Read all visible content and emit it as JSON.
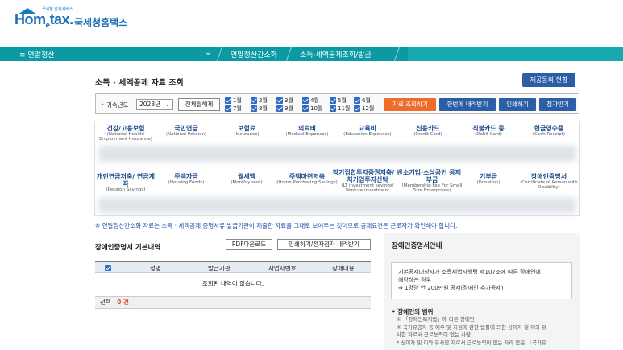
{
  "header": {
    "logo_home": "Hom",
    "logo_e": "e",
    "logo_tax": "tax.",
    "logo_tagline": "국세청 납세서비스",
    "logo_kr": "국세청홈택스"
  },
  "nav": {
    "menu_label": "≡  연말정산",
    "chevron": "⌄",
    "crumb1": "연말정산간소화",
    "crumb2": "소득·세액공제조회/발급"
  },
  "page": {
    "title": "소득 · 세액공제 자료 조회",
    "status_button": "제공동의 현황"
  },
  "filter": {
    "year_label": "귀속년도",
    "year_value": "2023년",
    "toggle_label": "전체월해제",
    "months": [
      "1월",
      "2월",
      "3월",
      "4월",
      "5월",
      "6월",
      "7월",
      "8월",
      "9월",
      "10월",
      "11월",
      "12월"
    ],
    "buttons": {
      "query": "자료 조회하기",
      "download_all": "한번에 내려받기",
      "print": "인쇄하기",
      "braille": "점자받기"
    }
  },
  "categories": [
    {
      "ko": "건강/고용보험",
      "en": "(National Health/ Employment Insurance)"
    },
    {
      "ko": "국민연금",
      "en": "(National Pension)"
    },
    {
      "ko": "보험료",
      "en": "(Insurance)"
    },
    {
      "ko": "의료비",
      "en": "(Medical Expenses)"
    },
    {
      "ko": "교육비",
      "en": "(Education Expenses)"
    },
    {
      "ko": "신용카드",
      "en": "(Credit Card)"
    },
    {
      "ko": "직불카드 등",
      "en": "(Debit Card)"
    },
    {
      "ko": "현금영수증",
      "en": "(Cash Receipt)"
    },
    {
      "ko": "개인연금저축/ 연금계좌",
      "en": "(Pension Savings)"
    },
    {
      "ko": "주택자금",
      "en": "(Housing Funds)"
    },
    {
      "ko": "월세액",
      "en": "(Monthly rent)"
    },
    {
      "ko": "주택마련저축",
      "en": "(Home Purchasing Savings)"
    },
    {
      "ko": "장기집합투자증권저축/ 벤처기업투자신탁",
      "en": "(LT investment savings/ Venture investment"
    },
    {
      "ko": "소기업·소상공인 공제부금",
      "en": "(Membership Fee For Small Size Enterprises)"
    },
    {
      "ko": "기부금",
      "en": "(Donation)"
    },
    {
      "ko": "장애인증명서",
      "en": "(Certificate of Person with Disability)"
    }
  ],
  "notice": "※ 연말정산간소화 자료는 소득 · 세액공제 증명서류 발급기관이 제출한 자료를 그대로 보여주는 것이므로 공제요건은 근로자가 확인해야 합니다.",
  "left": {
    "title": "장애인증명서 기본내역",
    "pdf_button": "PDF다운로드",
    "print_button": "인쇄하기/전자점자 내려받기",
    "columns": [
      "성명",
      "발급기관",
      "사업자번호",
      "장애내용"
    ],
    "empty_text": "조회된 내역이 없습니다.",
    "selection_label": "선택 : ",
    "selection_count": "0 건"
  },
  "guide": {
    "title": "장애인증명서안내",
    "info_line1": "기본공제대상자가 소득세법시행령 제107조에 따른 장애인에",
    "info_line2": "해당하는 경우",
    "info_line3": "⇒ 1명당 연 200만원 공제(장애인 추가공제)",
    "range_title": "• 장애인의 범위",
    "range_line1": "① 「장애인복지법」에 따른 장애인",
    "range_line2": "② 국가유공자 등 예우 및 지원에 관한 법률에 의한 상이자 및 이와 유",
    "range_line3": "사한 자로서 근로능력이 없는 사람",
    "range_line4": "* 상이자 및 이와 유사한 자로서 근로능력이 없는 자라 함은 「국가유"
  },
  "colors": {
    "nav_bg": "#0b9aa3",
    "primary_blue": "#2b5ea5",
    "query_orange": "#ef6d2c",
    "link_blue": "#1f4fb0"
  }
}
